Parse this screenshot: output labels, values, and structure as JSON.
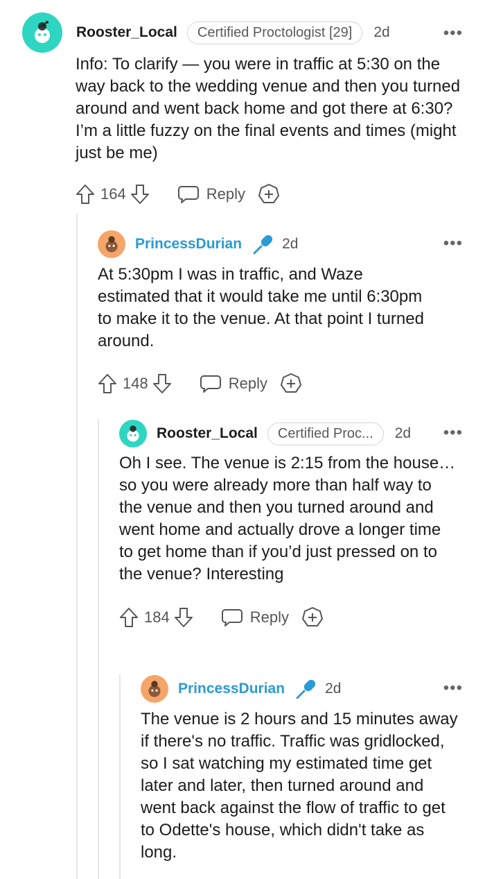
{
  "comments": [
    {
      "username": "Rooster_Local",
      "flair": "Certified Proctologist [29]",
      "age": "2d",
      "more": "•••",
      "body": "Info: To clarify — you were in traffic at 5:30 on the way back to the wedding venue and then you turned around and went back home and got there at 6:30? I’m a little fuzzy on the final events and times (might just be me)",
      "votes": "164",
      "reply_label": "Reply",
      "avatar_color": "#2ed6c2"
    },
    {
      "username": "PrincessDurian",
      "age": "2d",
      "more": "•••",
      "body": "At 5:30pm I was in traffic, and Waze estimated that it would take me until 6:30pm to make it to the venue. At that point I turned around.",
      "votes": "148",
      "reply_label": "Reply",
      "avatar_color": "#f6a56a"
    },
    {
      "username": "Rooster_Local",
      "flair": "Certified Proc...",
      "age": "2d",
      "more": "•••",
      "body": "Oh I see. The venue is 2:15 from the house… so you were already more than half way to the venue and then you turned around and went home and actually drove a longer time to get home than if you’d just pressed on to the venue? Interesting",
      "votes": "184",
      "reply_label": "Reply",
      "avatar_color": "#2ed6c2"
    },
    {
      "username": "PrincessDurian",
      "age": "2d",
      "more": "•••",
      "body": "The venue is 2 hours and 15 minutes away if there's no traffic. Traffic was gridlocked, so I sat watching my estimated time get later and later, then turned around and went back against the flow of traffic to get to Odette's house, which didn't take as long.",
      "avatar_color": "#f6a56a"
    }
  ],
  "colors": {
    "op_name": "#2a9bd6",
    "mic_icon": "#2a9bd6",
    "thread_line": "#e6e6e6"
  },
  "icons": [
    "snoo-avatar-icon",
    "upvote-arrow-icon",
    "downvote-arrow-icon",
    "reply-bubble-icon",
    "award-plus-icon",
    "microphone-icon",
    "more-options-icon"
  ]
}
